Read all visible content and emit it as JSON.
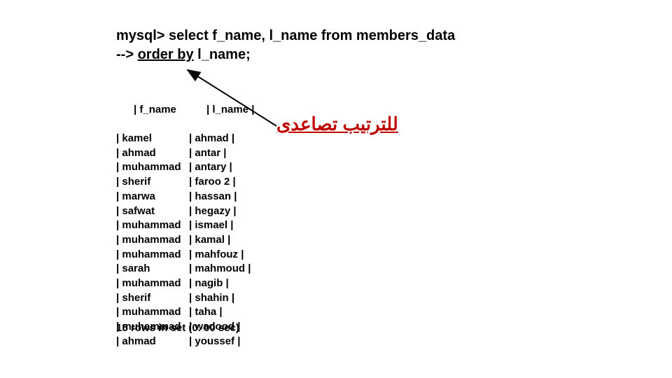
{
  "query": {
    "line1": "mysql> select f_name, l_name from members_data",
    "line2_prefix": "--> ",
    "line2_underlined": "order by",
    "line2_suffix": " l_name;"
  },
  "table": {
    "header": {
      "c1": "| f_name",
      "c2": "| l_name |"
    },
    "rows": [
      {
        "c1": "| kamel",
        "c2": "| ahmad |"
      },
      {
        "c1": "| ahmad",
        "c2": "| antar |"
      },
      {
        "c1": "| muhammad",
        "c2": "| antary |"
      },
      {
        "c1": "| sherif",
        "c2": "| faroo 2 |"
      },
      {
        "c1": "| marwa",
        "c2": "| hassan |"
      },
      {
        "c1": "| safwat",
        "c2": "| hegazy |"
      },
      {
        "c1": "| muhammad",
        "c2": "| ismael |"
      },
      {
        "c1": "| muhammad",
        "c2": "| kamal |"
      },
      {
        "c1": "| muhammad",
        "c2": "| mahfouz |"
      },
      {
        "c1": "| sarah",
        "c2": "| mahmoud |"
      },
      {
        "c1": "| muhammad",
        "c2": "| nagib |"
      },
      {
        "c1": "| sherif",
        "c2": "| shahin |"
      },
      {
        "c1": "| muhammad",
        "c2": "| taha |"
      },
      {
        "c1": "| muhammad",
        "c2": "| wadood |"
      },
      {
        "c1": "| ahmad",
        "c2": "| youssef |"
      }
    ]
  },
  "footer": "15 rows in set (0. 00 sec)",
  "annotation": "للترتيب تصاعدى"
}
